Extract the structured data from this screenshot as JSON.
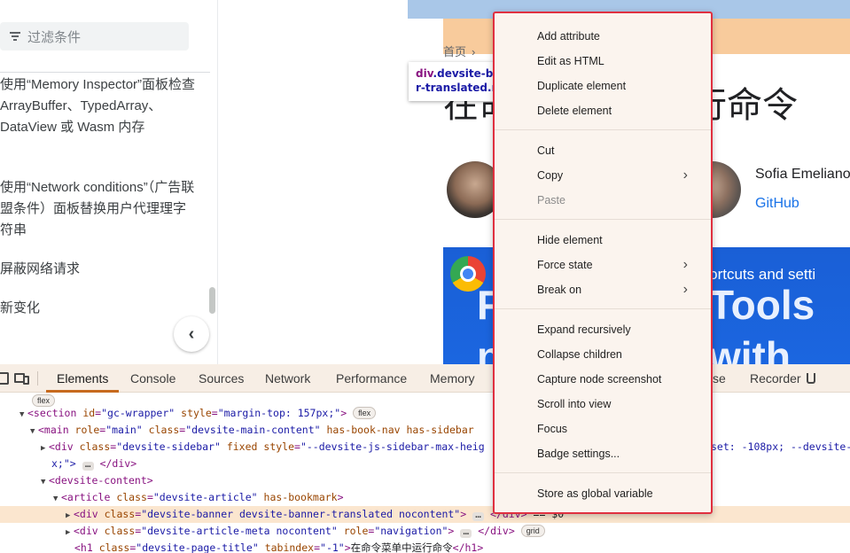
{
  "sidebar": {
    "filter_placeholder": "过滤条件",
    "items": [
      "使用“Memory Inspector”面板检查 ArrayBuffer、TypedArray、DataView 或 Wasm 内存",
      "使用“Network conditions”（广告联盟条件）面板替换用户代理理字符串",
      "屏蔽网络请求",
      "新变化"
    ],
    "collapse_glyph": "‹"
  },
  "page": {
    "breadcrumb_home": "首页",
    "breadcrumb_sep": "›",
    "heading": "在命令菜单中运行命令",
    "author_name": "Sofia Emelianova",
    "author_link": "GitHub",
    "video_subtitle": "h shortcuts and setti",
    "video_big_line1": "Tools",
    "video_big_line2": "with",
    "video_left_line1": "F",
    "video_left_line2": "n"
  },
  "inspect_tooltip": {
    "tag": "div",
    "class_line1": ".devsite-ba",
    "class_line2": "r-translated.n"
  },
  "devtools": {
    "tabs": [
      "Elements",
      "Console",
      "Sources",
      "Network",
      "Performance",
      "Memory",
      "se",
      "Recorder"
    ],
    "active_tab": "Elements",
    "dom_tree": {
      "r0_badge": "flex",
      "r1_open": "<section ",
      "r1_a1": "id",
      "r1_v1": "\"gc-wrapper\"",
      "r1_a2": "style",
      "r1_v2": "\"margin-top: 157px;\"",
      "r1_close": ">",
      "r1_badge": "flex",
      "r2_open": "<main ",
      "r2_a1": "role",
      "r2_v1": "\"main\"",
      "r2_a2": "class",
      "r2_v2": "\"devsite-main-content\"",
      "r2_a3": "has-book-nav has-sidebar",
      "r3_open": "<div ",
      "r3_a1": "class",
      "r3_v1": "\"devsite-sidebar\"",
      "r3_a2": "fixed",
      "r3_a3": "style",
      "r3_v3": "\"--devsite-js-sidebar-max-heig",
      "r3_tail": "set: -108px; --devsite-",
      "r4_v": "x;\">",
      "r4_dots": "…",
      "r4_close": "</div>",
      "r5_open": "<devsite-content>",
      "r6_open": "<article ",
      "r6_a1": "class",
      "r6_v1": "\"devsite-article\"",
      "r6_a2": "has-bookmark",
      "r6_close": ">",
      "r7_open": "<div ",
      "r7_a1": "class",
      "r7_v1": "\"devsite-banner devsite-banner-translated nocontent\"",
      "r7_close": ">",
      "r7_dots": "…",
      "r7_end": "</div>",
      "r7_dollar": "== $0",
      "r8_open": "<div ",
      "r8_a1": "class",
      "r8_v1": "\"devsite-article-meta nocontent\"",
      "r8_a2": "role",
      "r8_v2": "\"navigation\"",
      "r8_close": ">",
      "r8_dots": "…",
      "r8_end": "</div>",
      "r8_badge": "grid",
      "r9_open": "<h1 ",
      "r9_a1": "class",
      "r9_v1": "\"devsite-page-title\"",
      "r9_a2": "tabindex",
      "r9_v2": "\"-1\"",
      "r9_close": ">",
      "r9_text": "在命令菜单中运行命令",
      "r9_end": "</h1>"
    }
  },
  "context_menu": {
    "items": {
      "add_attribute": "Add attribute",
      "edit_html": "Edit as HTML",
      "duplicate": "Duplicate element",
      "delete": "Delete element",
      "cut": "Cut",
      "copy": "Copy",
      "paste": "Paste",
      "hide": "Hide element",
      "force_state": "Force state",
      "break_on": "Break on",
      "expand": "Expand recursively",
      "collapse": "Collapse children",
      "capture": "Capture node screenshot",
      "scroll": "Scroll into view",
      "focus": "Focus",
      "badge": "Badge settings...",
      "store": "Store as global variable"
    },
    "submenu_glyph": "›",
    "border_color": "#e03040"
  },
  "colors": {
    "devtools_tab_bg": "#f7eee5",
    "selected_row": "#fbe6cf",
    "active_tab_underline": "#c76a1e",
    "banner": "#f8cb9c",
    "video_bg": "#1a5fd6"
  }
}
